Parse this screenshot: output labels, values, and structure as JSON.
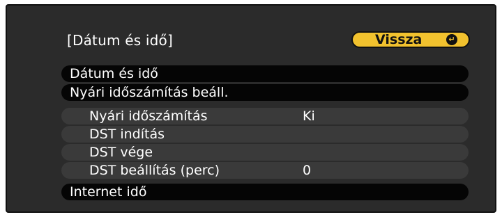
{
  "header": {
    "title": "[Dátum és idő]",
    "back_label": "Vissza",
    "back_icon": "enter-icon"
  },
  "menu": {
    "items": [
      {
        "label": "Dátum és idő",
        "value": ""
      },
      {
        "label": "Nyári időszámítás beáll.",
        "value": ""
      },
      {
        "label": "Nyári időszámítás",
        "value": "Ki"
      },
      {
        "label": "DST indítás",
        "value": ""
      },
      {
        "label": "DST vége",
        "value": ""
      },
      {
        "label": "DST beállítás (perc)",
        "value": "0"
      },
      {
        "label": "Internet idő",
        "value": ""
      }
    ]
  },
  "colors": {
    "accent": "#f2c22e",
    "background": "#2b2b2b",
    "row_dark": "#050505",
    "row_sub": "#3a3a3a"
  }
}
